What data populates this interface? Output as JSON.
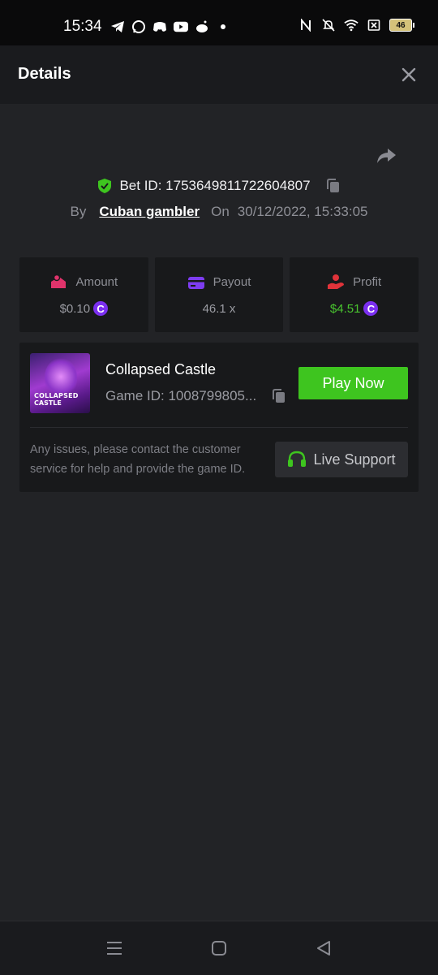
{
  "status_bar": {
    "time": "15:34",
    "battery": "46",
    "left_icons": [
      "telegram-icon",
      "whatsapp-icon",
      "discord-icon",
      "youtube-icon",
      "reddit-icon",
      "dot-icon"
    ],
    "right_icons": [
      "nfc-icon",
      "mute-icon",
      "wifi-icon",
      "sim-off-icon",
      "battery-icon"
    ]
  },
  "header": {
    "title": "Details"
  },
  "bet": {
    "label": "Bet ID: 1753649811722604807",
    "by_label": "By",
    "user": "Cuban gambler",
    "on_label": "On",
    "date": "30/12/2022, 15:33:05"
  },
  "stats": {
    "amount": {
      "label": "Amount",
      "value": "$0.10",
      "coin": "C"
    },
    "payout": {
      "label": "Payout",
      "value": "46.1 x"
    },
    "profit": {
      "label": "Profit",
      "value": "$4.51",
      "coin": "C"
    }
  },
  "game": {
    "name": "Collapsed Castle",
    "id_text": "Game ID: 1008799805...",
    "thumb_line1": "COLLAPSED",
    "thumb_line2": "CASTLE",
    "play_label": "Play Now"
  },
  "support": {
    "text": "Any issues, please contact the customer service for help and provide the game ID.",
    "button_label": "Live Support"
  },
  "colors": {
    "accent_green": "#3ec51f",
    "profit_green": "#49c42f",
    "coin_purple": "#7b2ff0",
    "amount_icon": "#e0336b",
    "payout_icon": "#7d3cf0",
    "profit_icon": "#e0333a"
  }
}
